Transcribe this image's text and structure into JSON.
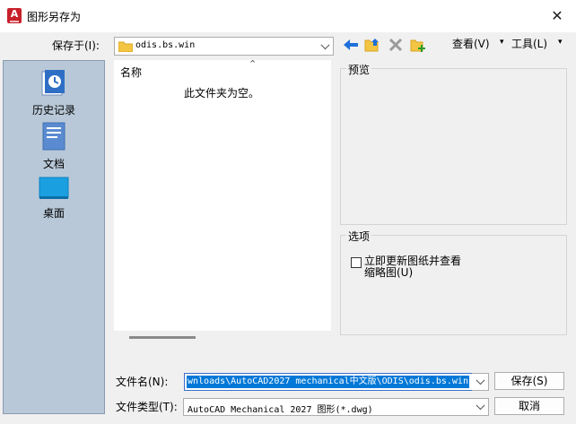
{
  "window": {
    "title": "图形另存为",
    "close_glyph": "✕"
  },
  "save_in": {
    "label": "保存于(I):",
    "value": "odis.bs.win"
  },
  "toolbar": {
    "view_label": "查看(V)",
    "tools_label": "工具(L)"
  },
  "sidebar": {
    "items": [
      {
        "label": "历史记录",
        "icon": "history-icon"
      },
      {
        "label": "文档",
        "icon": "documents-icon"
      },
      {
        "label": "桌面",
        "icon": "desktop-icon"
      }
    ]
  },
  "file_list": {
    "column_name": "名称",
    "empty_message": "此文件夹为空。"
  },
  "preview": {
    "title": "预览"
  },
  "options": {
    "title": "选项",
    "checkbox_line1": "立即更新图纸并查看",
    "checkbox_line2": "缩略图(U)",
    "checked": false
  },
  "filename": {
    "label": "文件名(N):",
    "value": "wnloads\\AutoCAD2027 mechanical中文版\\ODIS\\odis.bs.win"
  },
  "filetype": {
    "label": "文件类型(T):",
    "value": "AutoCAD Mechanical 2027 图形(*.dwg)"
  },
  "buttons": {
    "save": "保存(S)",
    "cancel": "取消"
  },
  "colors": {
    "accent": "#0078d7",
    "sidebar_bg": "#b8c8d8",
    "app_red": "#c8202a"
  }
}
